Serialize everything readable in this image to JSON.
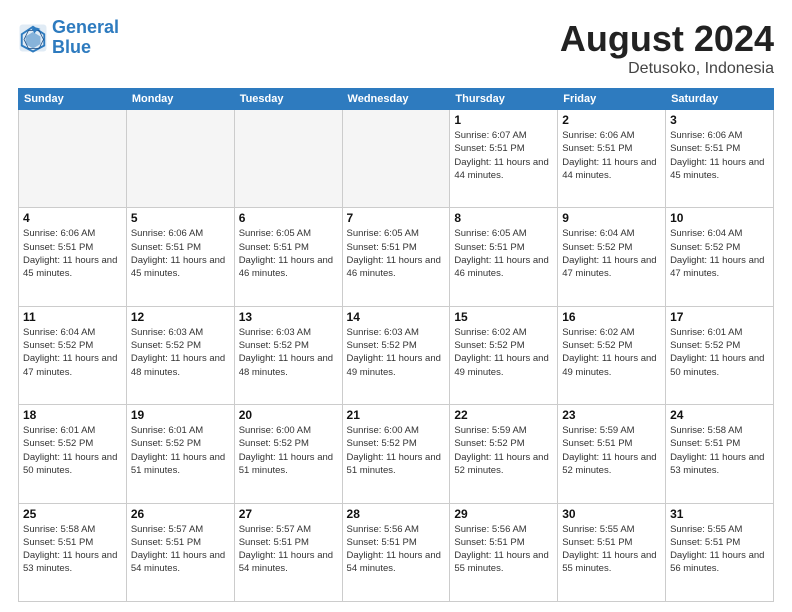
{
  "header": {
    "logo_line1": "General",
    "logo_line2": "Blue",
    "month_year": "August 2024",
    "location": "Detusoko, Indonesia"
  },
  "days_of_week": [
    "Sunday",
    "Monday",
    "Tuesday",
    "Wednesday",
    "Thursday",
    "Friday",
    "Saturday"
  ],
  "weeks": [
    [
      {
        "day": "",
        "empty": true
      },
      {
        "day": "",
        "empty": true
      },
      {
        "day": "",
        "empty": true
      },
      {
        "day": "",
        "empty": true
      },
      {
        "day": "1",
        "sunrise": "6:07 AM",
        "sunset": "5:51 PM",
        "daylight": "11 hours and 44 minutes."
      },
      {
        "day": "2",
        "sunrise": "6:06 AM",
        "sunset": "5:51 PM",
        "daylight": "11 hours and 44 minutes."
      },
      {
        "day": "3",
        "sunrise": "6:06 AM",
        "sunset": "5:51 PM",
        "daylight": "11 hours and 45 minutes."
      }
    ],
    [
      {
        "day": "4",
        "sunrise": "6:06 AM",
        "sunset": "5:51 PM",
        "daylight": "11 hours and 45 minutes."
      },
      {
        "day": "5",
        "sunrise": "6:06 AM",
        "sunset": "5:51 PM",
        "daylight": "11 hours and 45 minutes."
      },
      {
        "day": "6",
        "sunrise": "6:05 AM",
        "sunset": "5:51 PM",
        "daylight": "11 hours and 46 minutes."
      },
      {
        "day": "7",
        "sunrise": "6:05 AM",
        "sunset": "5:51 PM",
        "daylight": "11 hours and 46 minutes."
      },
      {
        "day": "8",
        "sunrise": "6:05 AM",
        "sunset": "5:51 PM",
        "daylight": "11 hours and 46 minutes."
      },
      {
        "day": "9",
        "sunrise": "6:04 AM",
        "sunset": "5:52 PM",
        "daylight": "11 hours and 47 minutes."
      },
      {
        "day": "10",
        "sunrise": "6:04 AM",
        "sunset": "5:52 PM",
        "daylight": "11 hours and 47 minutes."
      }
    ],
    [
      {
        "day": "11",
        "sunrise": "6:04 AM",
        "sunset": "5:52 PM",
        "daylight": "11 hours and 47 minutes."
      },
      {
        "day": "12",
        "sunrise": "6:03 AM",
        "sunset": "5:52 PM",
        "daylight": "11 hours and 48 minutes."
      },
      {
        "day": "13",
        "sunrise": "6:03 AM",
        "sunset": "5:52 PM",
        "daylight": "11 hours and 48 minutes."
      },
      {
        "day": "14",
        "sunrise": "6:03 AM",
        "sunset": "5:52 PM",
        "daylight": "11 hours and 49 minutes."
      },
      {
        "day": "15",
        "sunrise": "6:02 AM",
        "sunset": "5:52 PM",
        "daylight": "11 hours and 49 minutes."
      },
      {
        "day": "16",
        "sunrise": "6:02 AM",
        "sunset": "5:52 PM",
        "daylight": "11 hours and 49 minutes."
      },
      {
        "day": "17",
        "sunrise": "6:01 AM",
        "sunset": "5:52 PM",
        "daylight": "11 hours and 50 minutes."
      }
    ],
    [
      {
        "day": "18",
        "sunrise": "6:01 AM",
        "sunset": "5:52 PM",
        "daylight": "11 hours and 50 minutes."
      },
      {
        "day": "19",
        "sunrise": "6:01 AM",
        "sunset": "5:52 PM",
        "daylight": "11 hours and 51 minutes."
      },
      {
        "day": "20",
        "sunrise": "6:00 AM",
        "sunset": "5:52 PM",
        "daylight": "11 hours and 51 minutes."
      },
      {
        "day": "21",
        "sunrise": "6:00 AM",
        "sunset": "5:52 PM",
        "daylight": "11 hours and 51 minutes."
      },
      {
        "day": "22",
        "sunrise": "5:59 AM",
        "sunset": "5:52 PM",
        "daylight": "11 hours and 52 minutes."
      },
      {
        "day": "23",
        "sunrise": "5:59 AM",
        "sunset": "5:51 PM",
        "daylight": "11 hours and 52 minutes."
      },
      {
        "day": "24",
        "sunrise": "5:58 AM",
        "sunset": "5:51 PM",
        "daylight": "11 hours and 53 minutes."
      }
    ],
    [
      {
        "day": "25",
        "sunrise": "5:58 AM",
        "sunset": "5:51 PM",
        "daylight": "11 hours and 53 minutes."
      },
      {
        "day": "26",
        "sunrise": "5:57 AM",
        "sunset": "5:51 PM",
        "daylight": "11 hours and 54 minutes."
      },
      {
        "day": "27",
        "sunrise": "5:57 AM",
        "sunset": "5:51 PM",
        "daylight": "11 hours and 54 minutes."
      },
      {
        "day": "28",
        "sunrise": "5:56 AM",
        "sunset": "5:51 PM",
        "daylight": "11 hours and 54 minutes."
      },
      {
        "day": "29",
        "sunrise": "5:56 AM",
        "sunset": "5:51 PM",
        "daylight": "11 hours and 55 minutes."
      },
      {
        "day": "30",
        "sunrise": "5:55 AM",
        "sunset": "5:51 PM",
        "daylight": "11 hours and 55 minutes."
      },
      {
        "day": "31",
        "sunrise": "5:55 AM",
        "sunset": "5:51 PM",
        "daylight": "11 hours and 56 minutes."
      }
    ]
  ]
}
